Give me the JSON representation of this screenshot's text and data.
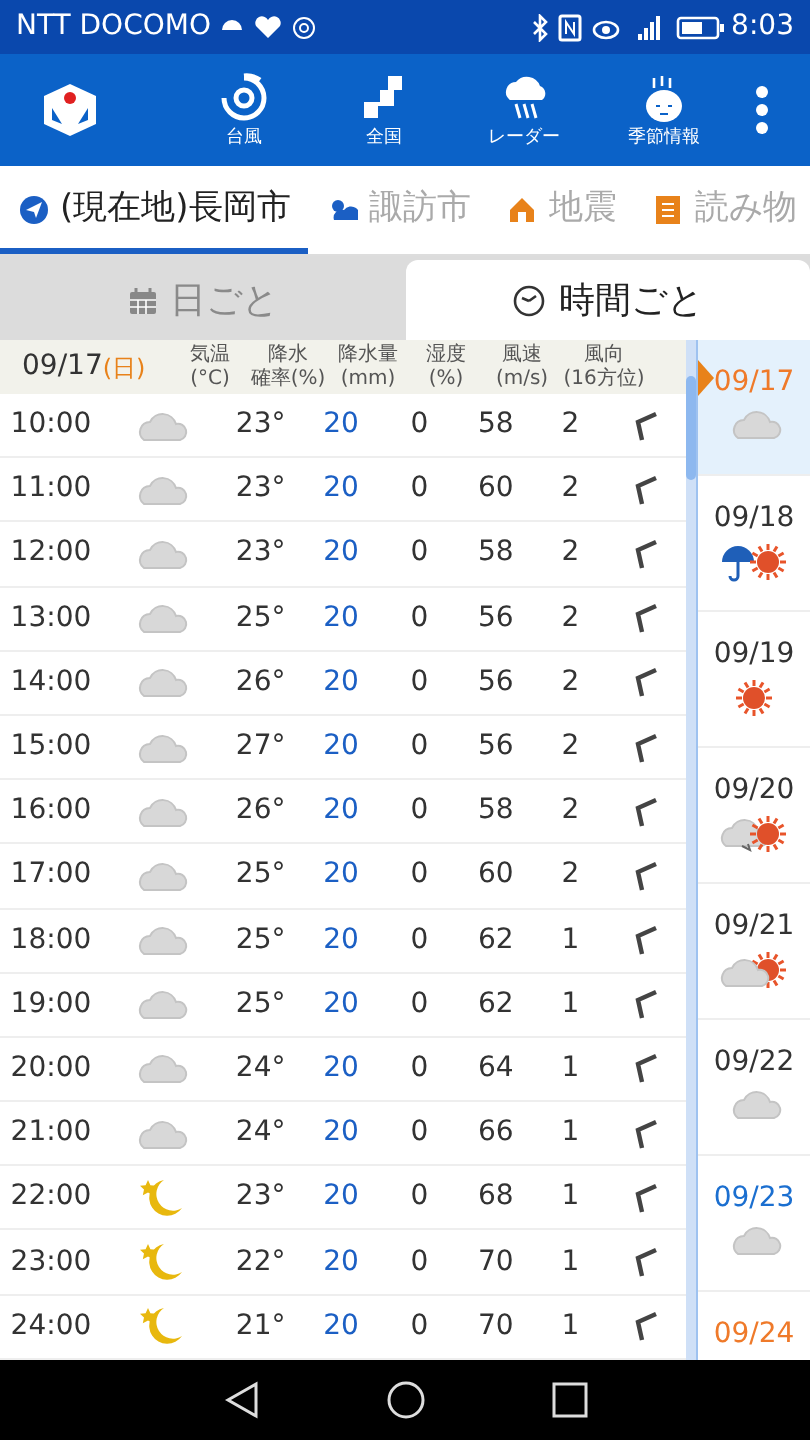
{
  "status_bar": {
    "carrier": "NTT DOCOMO",
    "time": "8:03"
  },
  "toolbar": {
    "items": [
      {
        "label": "台風",
        "kind": "typhoon"
      },
      {
        "label": "全国",
        "kind": "map"
      },
      {
        "label": "レーダー",
        "kind": "radar"
      },
      {
        "label": "季節情報",
        "kind": "season"
      }
    ]
  },
  "location_tabs": [
    {
      "label": "(現在地)長岡市",
      "kind": "location",
      "selected": true
    },
    {
      "label": "諏訪市",
      "kind": "weather",
      "selected": false
    },
    {
      "label": "地震",
      "kind": "quake",
      "selected": false
    },
    {
      "label": "読み物",
      "kind": "reading",
      "selected": false
    }
  ],
  "view_tabs": [
    {
      "label": "日ごと",
      "kind": "calendar",
      "selected": false
    },
    {
      "label": "時間ごと",
      "kind": "clock",
      "selected": true
    }
  ],
  "table": {
    "date": "09/17",
    "weekday": "(日)",
    "columns": [
      [
        "気温",
        "(°C)"
      ],
      [
        "降水",
        "確率(%)"
      ],
      [
        "降水量",
        "(mm)"
      ],
      [
        "湿度",
        "(%)"
      ],
      [
        "風速",
        "(m/s)"
      ],
      [
        "風向",
        "(16方位)"
      ]
    ],
    "rows": [
      {
        "time": "10:00",
        "kind": "cloudy",
        "temp": "23°",
        "pop": "20",
        "rain": "0",
        "humidity": "58",
        "wind": "2"
      },
      {
        "time": "11:00",
        "kind": "cloudy",
        "temp": "23°",
        "pop": "20",
        "rain": "0",
        "humidity": "60",
        "wind": "2"
      },
      {
        "time": "12:00",
        "kind": "cloudy",
        "temp": "23°",
        "pop": "20",
        "rain": "0",
        "humidity": "58",
        "wind": "2"
      },
      {
        "time": "13:00",
        "kind": "cloudy",
        "temp": "25°",
        "pop": "20",
        "rain": "0",
        "humidity": "56",
        "wind": "2"
      },
      {
        "time": "14:00",
        "kind": "cloudy",
        "temp": "26°",
        "pop": "20",
        "rain": "0",
        "humidity": "56",
        "wind": "2"
      },
      {
        "time": "15:00",
        "kind": "cloudy",
        "temp": "27°",
        "pop": "20",
        "rain": "0",
        "humidity": "56",
        "wind": "2"
      },
      {
        "time": "16:00",
        "kind": "cloudy",
        "temp": "26°",
        "pop": "20",
        "rain": "0",
        "humidity": "58",
        "wind": "2"
      },
      {
        "time": "17:00",
        "kind": "cloudy",
        "temp": "25°",
        "pop": "20",
        "rain": "0",
        "humidity": "60",
        "wind": "2"
      },
      {
        "time": "18:00",
        "kind": "cloudy",
        "temp": "25°",
        "pop": "20",
        "rain": "0",
        "humidity": "62",
        "wind": "1"
      },
      {
        "time": "19:00",
        "kind": "cloudy",
        "temp": "25°",
        "pop": "20",
        "rain": "0",
        "humidity": "62",
        "wind": "1"
      },
      {
        "time": "20:00",
        "kind": "cloudy",
        "temp": "24°",
        "pop": "20",
        "rain": "0",
        "humidity": "64",
        "wind": "1"
      },
      {
        "time": "21:00",
        "kind": "cloudy",
        "temp": "24°",
        "pop": "20",
        "rain": "0",
        "humidity": "66",
        "wind": "1"
      },
      {
        "time": "22:00",
        "kind": "night",
        "temp": "23°",
        "pop": "20",
        "rain": "0",
        "humidity": "68",
        "wind": "1"
      },
      {
        "time": "23:00",
        "kind": "night",
        "temp": "22°",
        "pop": "20",
        "rain": "0",
        "humidity": "70",
        "wind": "1"
      },
      {
        "time": "24:00",
        "kind": "night",
        "temp": "21°",
        "pop": "20",
        "rain": "0",
        "humidity": "70",
        "wind": "1"
      }
    ]
  },
  "days": [
    {
      "date": "09/17",
      "color": "#ef7a2a",
      "kind": "cloudy",
      "selected": true
    },
    {
      "date": "09/18",
      "color": "#333333",
      "kind": "rain_sun",
      "selected": false
    },
    {
      "date": "09/19",
      "color": "#333333",
      "kind": "sunny",
      "selected": false
    },
    {
      "date": "09/20",
      "color": "#333333",
      "kind": "cloud_to_sun",
      "selected": false
    },
    {
      "date": "09/21",
      "color": "#333333",
      "kind": "cloud_sun",
      "selected": false
    },
    {
      "date": "09/22",
      "color": "#333333",
      "kind": "cloudy",
      "selected": false
    },
    {
      "date": "09/23",
      "color": "#1b6fd0",
      "kind": "cloudy",
      "selected": false
    },
    {
      "date": "09/24",
      "color": "#ef7a2a",
      "selected": false
    }
  ]
}
